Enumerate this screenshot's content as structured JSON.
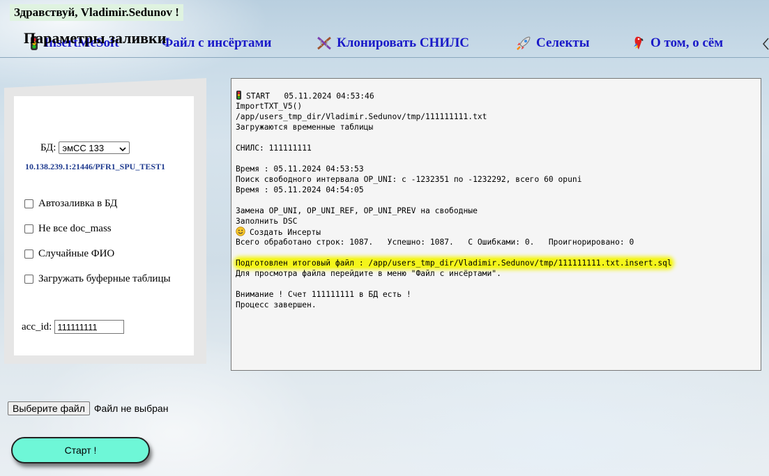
{
  "header": {
    "greeting": "Здравствуй, Vladimir.Sedunov !"
  },
  "nav": [
    {
      "label": "InsertMeSoft",
      "icon": "traffic-light-icon"
    },
    {
      "label": "Файл с инсёртами",
      "icon": ""
    },
    {
      "label": "Клонировать СНИЛС",
      "icon": "dna-icon"
    },
    {
      "label": "Селекты",
      "icon": "rocket-icon"
    },
    {
      "label": "О том, о сём",
      "icon": "parrot-icon"
    }
  ],
  "params": {
    "title": "Параметры заливки",
    "db_label": "БД:",
    "db_selected": "эмСС 133",
    "db_connection": "10.138.239.1:21446/PFR1_SPU_TEST1",
    "checkboxes": [
      {
        "label": "Автозаливка в БД",
        "checked": false
      },
      {
        "label": "Не все doc_mass",
        "checked": false
      },
      {
        "label": "Случайные ФИО",
        "checked": false
      },
      {
        "label": "Загружать буферные таблицы",
        "checked": false
      }
    ],
    "acc_label": "acc_id:",
    "acc_value": "111111111"
  },
  "log": {
    "lines": [
      {
        "text": "START   05.11.2024 04:53:46",
        "icon": "traffic-light-icon"
      },
      {
        "text": "ImportTXT_V5()"
      },
      {
        "text": "/app/users_tmp_dir/Vladimir.Sedunov/tmp/111111111.txt"
      },
      {
        "text": "Загружаются временные таблицы"
      },
      {
        "text": ""
      },
      {
        "text": "СНИЛС: 111111111"
      },
      {
        "text": ""
      },
      {
        "text": "Время : 05.11.2024 04:53:53"
      },
      {
        "text": "Поиск свободного интервала OP_UNI: с -1232351 по -1232292, всего 60 opuni"
      },
      {
        "text": "Время : 05.11.2024 04:54:05"
      },
      {
        "text": ""
      },
      {
        "text": "Замена OP_UNI, OP_UNI_REF, OP_UNI_PREV на свободные"
      },
      {
        "text": "Заполнить DSC"
      },
      {
        "text": "Создать Инсерты",
        "icon": "smiley-icon"
      },
      {
        "text": "Всего обработано строк: 1087.   Успешно: 1087.   С Ошибками: 0.   Проигнорировано: 0"
      },
      {
        "text": ""
      },
      {
        "text": "Подготовлен итоговый файл : /app/users_tmp_dir/Vladimir.Sedunov/tmp/111111111.txt.insert.sql",
        "highlight": true
      },
      {
        "text": "Для просмотра файла перейдите в меню \"Файл с инсёртами\"."
      },
      {
        "text": ""
      },
      {
        "text": "Внимание ! Счет 111111111 в БД есть !"
      },
      {
        "text": "Процесс завершен."
      }
    ]
  },
  "file": {
    "button_label": "Выберите файл",
    "status": "Файл не выбран"
  },
  "start_label": "Старт !"
}
